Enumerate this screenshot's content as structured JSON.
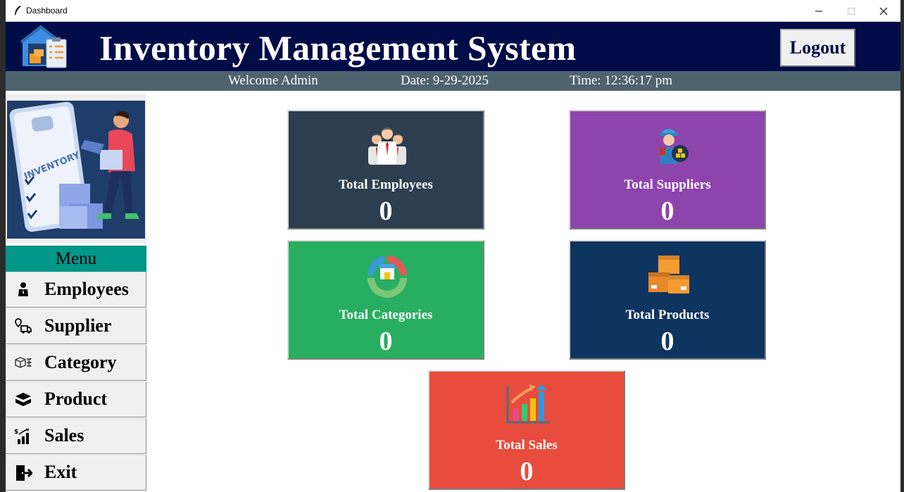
{
  "window": {
    "title": "Dashboard"
  },
  "header": {
    "title": "Inventory Management System",
    "logout_label": "Logout"
  },
  "infobar": {
    "welcome": "Welcome Admin",
    "date": "Date: 9-29-2025",
    "time": "Time: 12:36:17 pm"
  },
  "sidebar": {
    "menu_title": "Menu",
    "items": [
      {
        "label": "Employees",
        "icon": "employee-icon"
      },
      {
        "label": "Supplier",
        "icon": "supplier-icon"
      },
      {
        "label": "Category",
        "icon": "category-icon"
      },
      {
        "label": "Product",
        "icon": "product-icon"
      },
      {
        "label": "Sales",
        "icon": "sales-icon"
      },
      {
        "label": "Exit",
        "icon": "exit-icon"
      }
    ]
  },
  "cards": [
    {
      "label": "Total Employees",
      "value": "0",
      "color": "#2c3e50",
      "icon": "employees-group-icon"
    },
    {
      "label": "Total Suppliers",
      "value": "0",
      "color": "#8e44ad",
      "icon": "supplier-worker-icon"
    },
    {
      "label": "Total Categories",
      "value": "0",
      "color": "#27ae60",
      "icon": "categories-store-icon"
    },
    {
      "label": "Total Products",
      "value": "0",
      "color": "#0e3460",
      "icon": "boxes-icon"
    },
    {
      "label": "Total Sales",
      "value": "0",
      "color": "#e74c3c",
      "icon": "sales-chart-icon"
    }
  ],
  "colors": {
    "header": "#010c48",
    "infobar": "#4d636e",
    "menu_head": "#009688"
  }
}
